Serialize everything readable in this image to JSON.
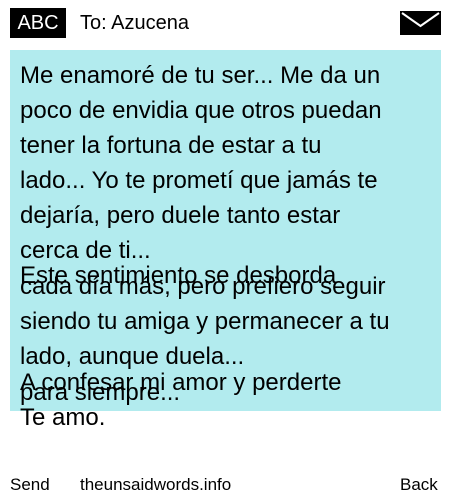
{
  "header": {
    "input_mode": "ABC",
    "to_text": "To: Azucena",
    "envelope_icon": "envelope-icon"
  },
  "message": {
    "lines": [
      "Me enamoré de tu ser... Me da un",
      "poco de envidia que otros puedan",
      "tener la fortuna de estar a tu",
      "lado... Yo te prometí que jamás te",
      "dejaría, pero duele tanto estar",
      "cerca de ti...",
      "Este sentimiento se desborda",
      "cada día más, pero prefiero seguir",
      "siendo tu amiga y permanecer a tu",
      "lado, aunque duela...",
      "A confesar mi amor y perderte",
      "para siempre...",
      "Te amo."
    ]
  },
  "colors": {
    "message_background": "#b2ebee",
    "badge_background": "#000000"
  },
  "footer": {
    "left": "Send",
    "center": "theunsaidwords.info",
    "right": "Back"
  }
}
